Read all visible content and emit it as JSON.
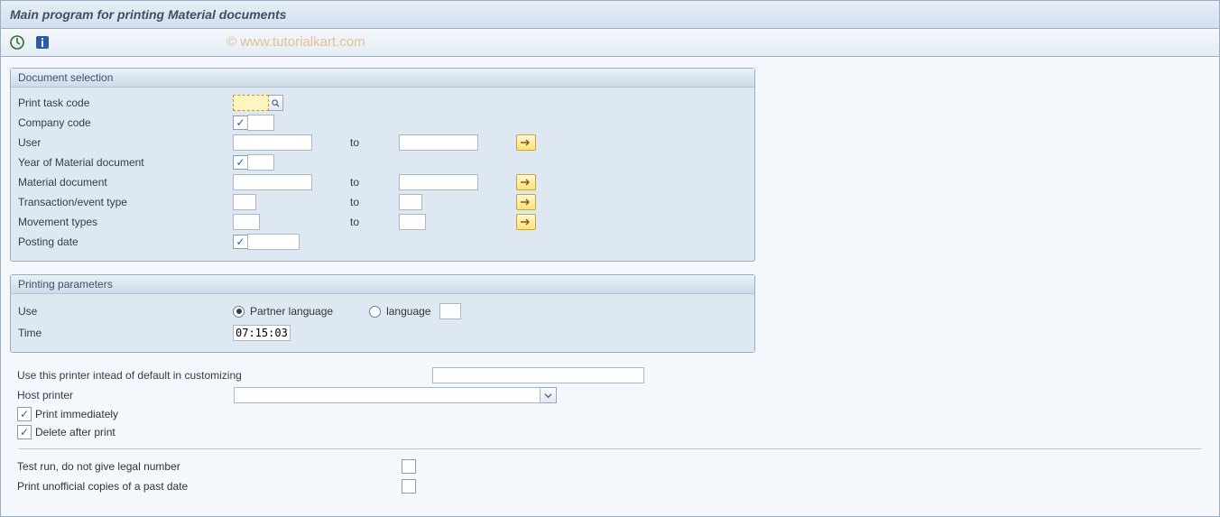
{
  "title": "Main program for printing Material documents",
  "watermark": "© www.tutorialkart.com",
  "group_doc_sel": {
    "title": "Document selection",
    "print_task_code": "Print task code",
    "company_code": "Company code",
    "user": "User",
    "year_mat_doc": "Year of Material document",
    "material_doc": "Material document",
    "trans_event_type": "Transaction/event type",
    "movement_types": "Movement types",
    "posting_date": "Posting date",
    "to": "to"
  },
  "group_print_params": {
    "title": "Printing parameters",
    "use": "Use",
    "radio_partner_lang": "Partner language",
    "radio_language": "language",
    "time_label": "Time",
    "time_value": "07:15:03"
  },
  "printer_override": "Use this printer intead of default in customizing",
  "host_printer": "Host printer",
  "print_immediately": "Print immediately",
  "delete_after_print": "Delete after print",
  "test_run": "Test run, do not give legal number",
  "print_unofficial": "Print unofficial copies of a past date"
}
